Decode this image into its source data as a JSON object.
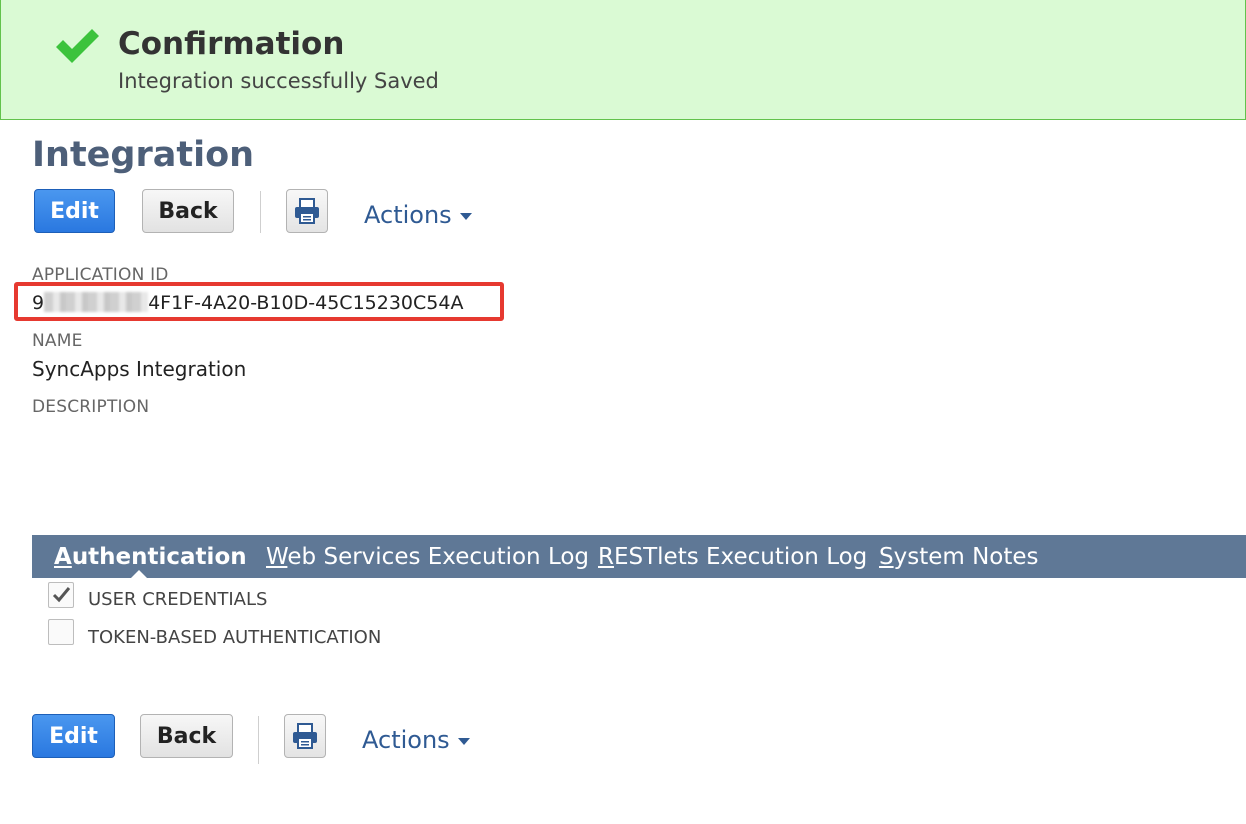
{
  "confirmation": {
    "title": "Confirmation",
    "message": "Integration successfully Saved",
    "icon": "check-icon",
    "accent_color": "#3cc33c"
  },
  "page": {
    "title": "Integration"
  },
  "toolbar": {
    "edit_label": "Edit",
    "back_label": "Back",
    "print_icon": "print-icon",
    "actions_label": "Actions"
  },
  "fields": {
    "application_id": {
      "label": "APPLICATION ID",
      "prefix": "9",
      "value": "4F1F-4A20-B10D-45C15230C54A"
    },
    "name": {
      "label": "NAME",
      "value": "SyncApps Integration"
    },
    "description": {
      "label": "DESCRIPTION",
      "value": ""
    }
  },
  "tabs": [
    {
      "first": "A",
      "rest": "uthentication",
      "active": true
    },
    {
      "first": "W",
      "rest": "eb Services Execution Log",
      "active": false
    },
    {
      "first": "R",
      "rest": "ESTlets Execution Log",
      "active": false
    },
    {
      "first": "S",
      "rest": "ystem Notes",
      "active": false
    }
  ],
  "authentication": {
    "user_credentials": {
      "label": "USER CREDENTIALS",
      "checked": true
    },
    "token_based": {
      "label": "TOKEN-BASED AUTHENTICATION",
      "checked": false
    }
  },
  "colors": {
    "banner_bg": "#dafad4",
    "title_color": "#4d5f79",
    "tab_bar": "#5f7896",
    "edit_button": "#2a78e0",
    "link_color": "#2f5a93",
    "highlight_box": "#e63930"
  }
}
